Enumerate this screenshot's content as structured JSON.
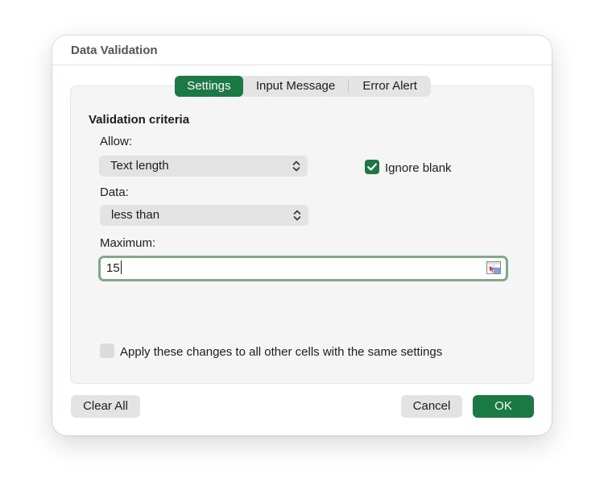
{
  "dialog": {
    "title": "Data Validation"
  },
  "tabs": [
    {
      "label": "Settings",
      "active": true
    },
    {
      "label": "Input Message",
      "active": false
    },
    {
      "label": "Error Alert",
      "active": false
    }
  ],
  "settings": {
    "section_heading": "Validation criteria",
    "allow": {
      "label": "Allow:",
      "value": "Text length"
    },
    "ignore_blank": {
      "label": "Ignore blank",
      "checked": true
    },
    "data": {
      "label": "Data:",
      "value": "less than"
    },
    "maximum": {
      "label": "Maximum:",
      "value": "15"
    },
    "apply_all": {
      "label": "Apply these changes to all other cells with the same settings",
      "checked": false
    }
  },
  "buttons": {
    "clear_all": "Clear All",
    "cancel": "Cancel",
    "ok": "OK"
  },
  "colors": {
    "accent": "#1a7a43",
    "focus_ring": "#7fa989"
  },
  "icons": [
    "chevron-updown-icon",
    "checkmark-icon",
    "range-select-icon"
  ]
}
